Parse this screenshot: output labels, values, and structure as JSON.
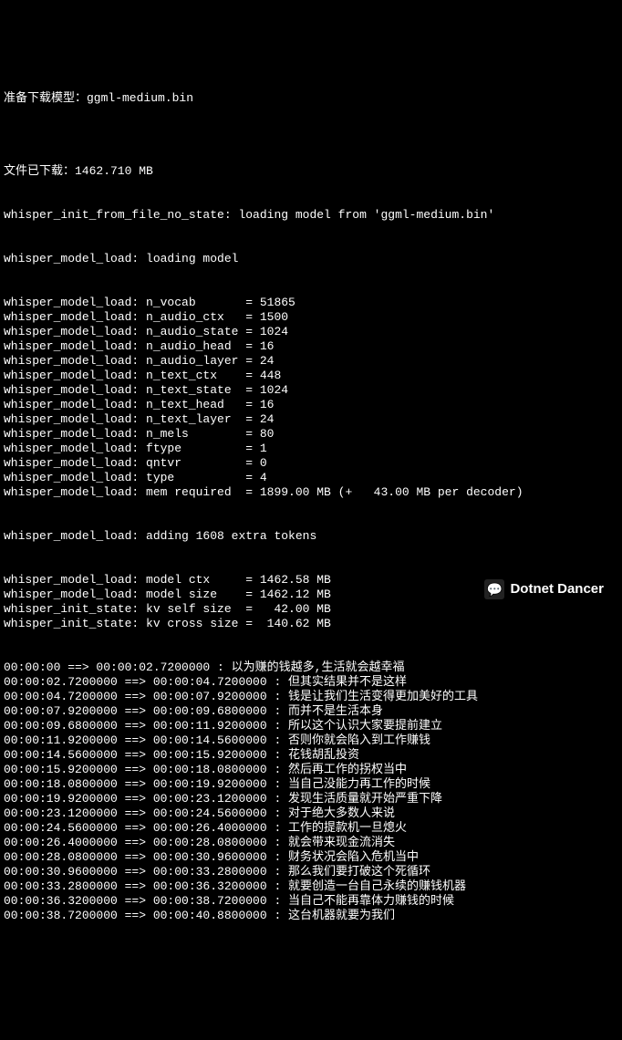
{
  "header": {
    "line1": "准备下载模型：ggml-medium.bin",
    "blank": "",
    "line2": "文件已下载：1462.710 MB",
    "line3": "whisper_init_from_file_no_state: loading model from 'ggml-medium.bin'",
    "line4": "whisper_model_load: loading model"
  },
  "params": [
    {
      "key": "whisper_model_load: n_vocab       ",
      "eq": "= ",
      "val": "51865"
    },
    {
      "key": "whisper_model_load: n_audio_ctx   ",
      "eq": "= ",
      "val": "1500"
    },
    {
      "key": "whisper_model_load: n_audio_state ",
      "eq": "= ",
      "val": "1024"
    },
    {
      "key": "whisper_model_load: n_audio_head  ",
      "eq": "= ",
      "val": "16"
    },
    {
      "key": "whisper_model_load: n_audio_layer ",
      "eq": "= ",
      "val": "24"
    },
    {
      "key": "whisper_model_load: n_text_ctx    ",
      "eq": "= ",
      "val": "448"
    },
    {
      "key": "whisper_model_load: n_text_state  ",
      "eq": "= ",
      "val": "1024"
    },
    {
      "key": "whisper_model_load: n_text_head   ",
      "eq": "= ",
      "val": "16"
    },
    {
      "key": "whisper_model_load: n_text_layer  ",
      "eq": "= ",
      "val": "24"
    },
    {
      "key": "whisper_model_load: n_mels        ",
      "eq": "= ",
      "val": "80"
    },
    {
      "key": "whisper_model_load: ftype         ",
      "eq": "= ",
      "val": "1"
    },
    {
      "key": "whisper_model_load: qntvr         ",
      "eq": "= ",
      "val": "0"
    },
    {
      "key": "whisper_model_load: type          ",
      "eq": "= ",
      "val": "4"
    },
    {
      "key": "whisper_model_load: mem required  ",
      "eq": "= ",
      "val": "1899.00 MB (+   43.00 MB per decoder)"
    }
  ],
  "extra": "whisper_model_load: adding 1608 extra tokens",
  "params2": [
    {
      "key": "whisper_model_load: model ctx     ",
      "eq": "= ",
      "val": "1462.58 MB"
    },
    {
      "key": "whisper_model_load: model size    ",
      "eq": "= ",
      "val": "1462.12 MB"
    },
    {
      "key": "whisper_init_state: kv self size  ",
      "eq": "=   ",
      "val": "42.00 MB"
    },
    {
      "key": "whisper_init_state: kv cross size ",
      "eq": "=  ",
      "val": "140.62 MB"
    }
  ],
  "transcript": [
    {
      "start": "00:00:00 ==> ",
      "end": "00:00:02.7200000 : ",
      "text": "以为赚的钱越多,生活就会越幸福"
    },
    {
      "start": "00:00:02.7200000 ==> ",
      "end": "00:00:04.7200000 : ",
      "text": "但其实结果并不是这样"
    },
    {
      "start": "00:00:04.7200000 ==> ",
      "end": "00:00:07.9200000 : ",
      "text": "钱是让我们生活变得更加美好的工具"
    },
    {
      "start": "00:00:07.9200000 ==> ",
      "end": "00:00:09.6800000 : ",
      "text": "而并不是生活本身"
    },
    {
      "start": "00:00:09.6800000 ==> ",
      "end": "00:00:11.9200000 : ",
      "text": "所以这个认识大家要提前建立"
    },
    {
      "start": "00:00:11.9200000 ==> ",
      "end": "00:00:14.5600000 : ",
      "text": "否则你就会陷入到工作赚钱"
    },
    {
      "start": "00:00:14.5600000 ==> ",
      "end": "00:00:15.9200000 : ",
      "text": "花钱胡乱投资"
    },
    {
      "start": "00:00:15.9200000 ==> ",
      "end": "00:00:18.0800000 : ",
      "text": "然后再工作的拐权当中"
    },
    {
      "start": "00:00:18.0800000 ==> ",
      "end": "00:00:19.9200000 : ",
      "text": "当自己没能力再工作的时候"
    },
    {
      "start": "00:00:19.9200000 ==> ",
      "end": "00:00:23.1200000 : ",
      "text": "发现生活质量就开始严重下降"
    },
    {
      "start": "00:00:23.1200000 ==> ",
      "end": "00:00:24.5600000 : ",
      "text": "对于绝大多数人来说"
    },
    {
      "start": "00:00:24.5600000 ==> ",
      "end": "00:00:26.4000000 : ",
      "text": "工作的提款机一旦熄火"
    },
    {
      "start": "00:00:26.4000000 ==> ",
      "end": "00:00:28.0800000 : ",
      "text": "就会带来现金流消失"
    },
    {
      "start": "00:00:28.0800000 ==> ",
      "end": "00:00:30.9600000 : ",
      "text": "财务状况会陷入危机当中"
    },
    {
      "start": "00:00:30.9600000 ==> ",
      "end": "00:00:33.2800000 : ",
      "text": "那么我们要打破这个死循环"
    },
    {
      "start": "00:00:33.2800000 ==> ",
      "end": "00:00:36.3200000 : ",
      "text": "就要创造一台自己永续的赚钱机器"
    },
    {
      "start": "00:00:36.3200000 ==> ",
      "end": "00:00:38.7200000 : ",
      "text": "当自己不能再靠体力赚钱的时候"
    },
    {
      "start": "00:00:38.7200000 ==> ",
      "end": "00:00:40.8800000 : ",
      "text": "这台机器就要为我们"
    }
  ],
  "watermark": {
    "icon": "💬",
    "text": "Dotnet Dancer"
  }
}
